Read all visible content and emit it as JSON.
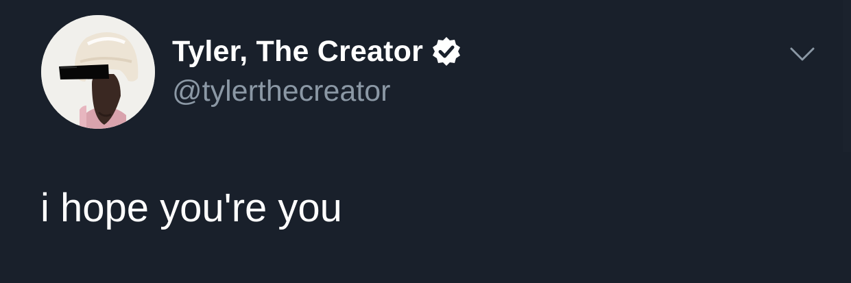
{
  "tweet": {
    "author": {
      "display_name": "Tyler, The Creator",
      "handle": "@tylerthecreator",
      "verified": true,
      "avatar_icon": "profile-photo"
    },
    "menu_icon": "chevron-down-icon",
    "text": "i hope you're you"
  },
  "colors": {
    "background": "#19202b",
    "name_text": "#ffffff",
    "handle_text": "#8b98a5",
    "tweet_text": "#ffffff",
    "chevron": "#8b98a5",
    "badge_fill": "#ffffff",
    "badge_check": "#19202b"
  }
}
